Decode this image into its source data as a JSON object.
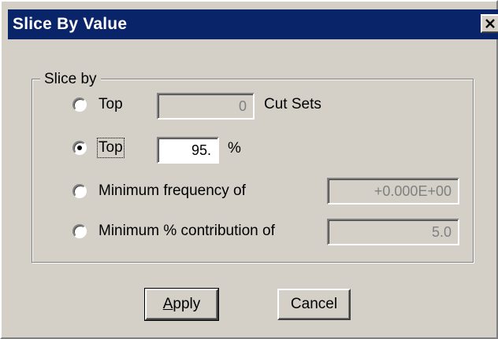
{
  "window": {
    "title": "Slice By Value",
    "close_glyph": "✕"
  },
  "group": {
    "legend": "Slice by"
  },
  "options": [
    {
      "label": "Top",
      "checked": false,
      "value": "0",
      "suffix": "Cut Sets",
      "enabled": false
    },
    {
      "label": "Top",
      "checked": true,
      "value": "95.",
      "suffix": "%",
      "enabled": true
    },
    {
      "label": "Minimum frequency of",
      "checked": false,
      "value": "+0.000E+00",
      "suffix": "",
      "enabled": false
    },
    {
      "label": "Minimum % contribution of",
      "checked": false,
      "value": "5.0",
      "suffix": "",
      "enabled": false
    }
  ],
  "buttons": {
    "apply_mnemonic": "A",
    "apply_rest": "pply",
    "cancel": "Cancel"
  },
  "colors": {
    "titlebar": "#0a246a",
    "face": "#d4d0c8"
  }
}
